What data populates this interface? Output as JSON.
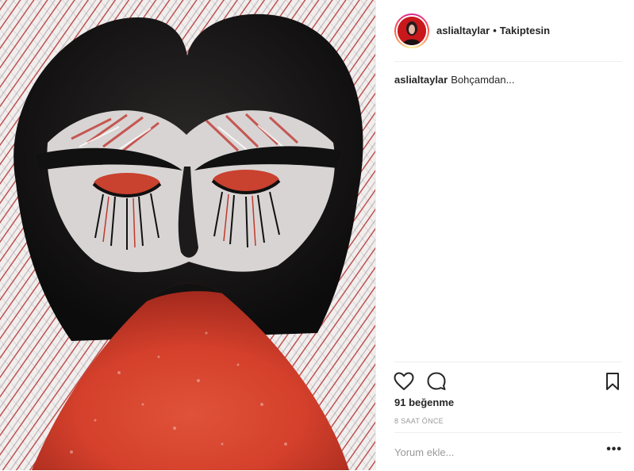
{
  "post": {
    "username": "aslialtaylar",
    "separator": "•",
    "follow_status": "Takiptesin",
    "caption_user": "aslialtaylar",
    "caption_text": "Bohçamdan...",
    "likes": "91 beğenme",
    "time_ago": "8 SAAT ÖNCE",
    "comment_placeholder": "Yorum ekle...",
    "more_options": "•••"
  },
  "icons": {
    "like": "heart-icon",
    "comment": "comment-bubble-icon",
    "save": "bookmark-icon",
    "more": "more-options-icon"
  },
  "colors": {
    "text": "#262626",
    "muted": "#999999",
    "divider": "#efefef",
    "artwork_red": "#d8452c",
    "artwork_black": "#1a1a1a"
  }
}
